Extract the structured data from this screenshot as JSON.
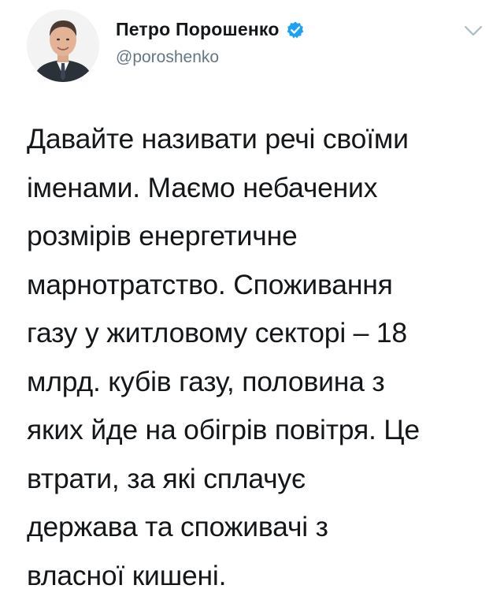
{
  "tweet": {
    "author_name": "Петро Порошенко",
    "handle": "@poroshenko",
    "verified": true,
    "avatar_icon": "profile-photo",
    "menu_icon": "chevron-down-icon",
    "text": "Давайте називати речі своїми\nіменами. Маємо небачених\nрозмірів енергетичне\nмарнотратство. Споживання\nгазу у житловому секторі – 18\nмлрд. кубів газу, половина з\nяких йде на обігрів повітря. Це\nвтрати, за які сплачує\nдержава та споживачі з\nвласної кишені."
  },
  "colors": {
    "verified_badge": "#1da1f2",
    "handle": "#657786",
    "text": "#14171a",
    "caret": "#aab8c2"
  }
}
